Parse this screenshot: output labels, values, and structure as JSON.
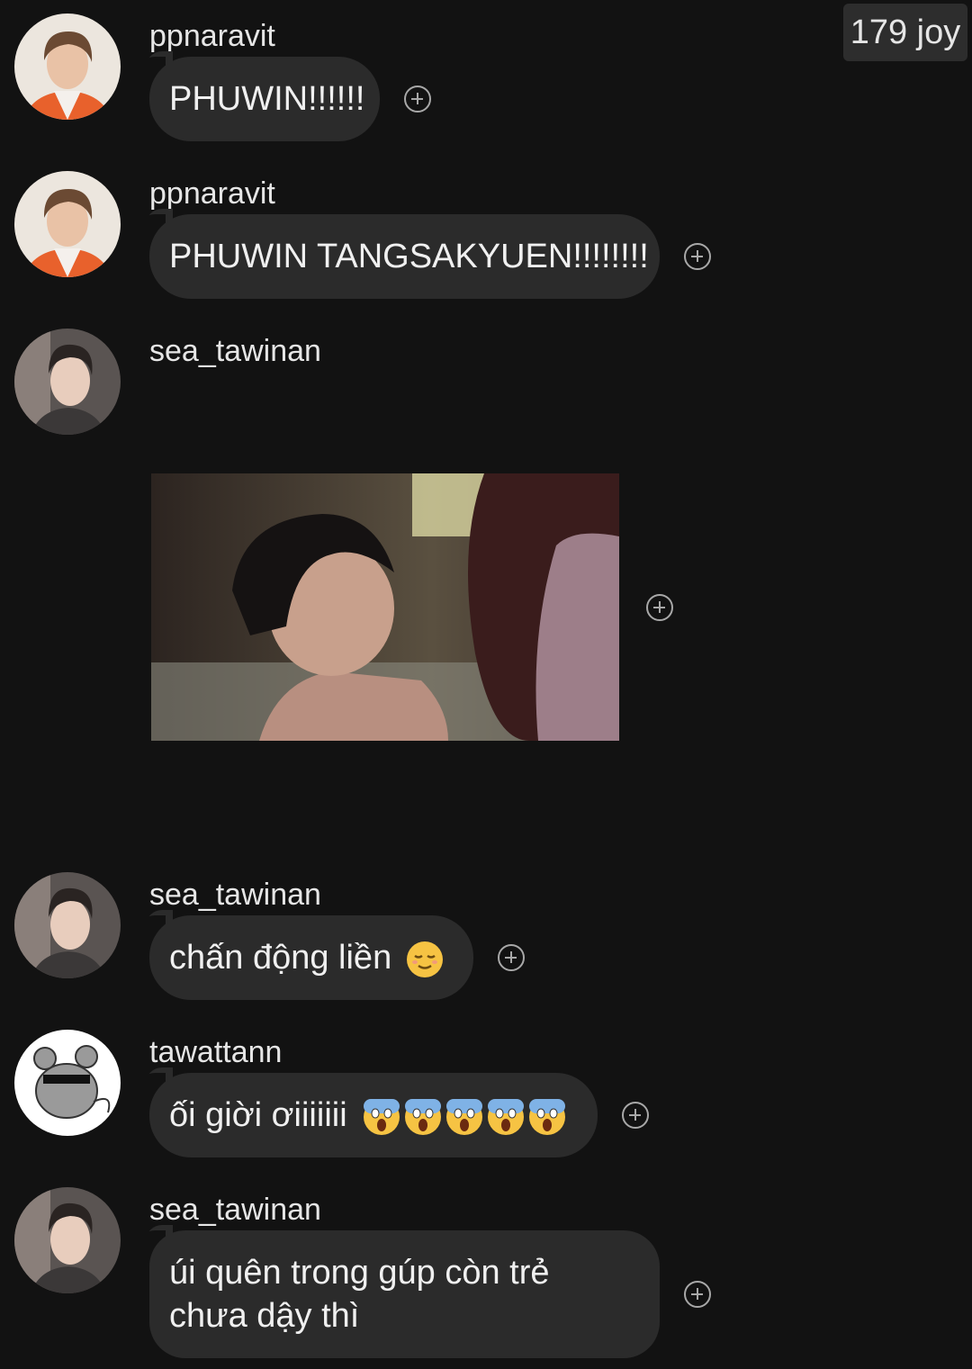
{
  "header": {
    "badge": "179 joy"
  },
  "messages": [
    {
      "username": "ppnaravit",
      "text": "PHUWIN!!!!!!"
    },
    {
      "username": "ppnaravit",
      "text": "PHUWIN TANGSAKYUEN!!!!!!!!"
    },
    {
      "username": "sea_tawinan",
      "attachment": "photo"
    },
    {
      "username": "sea_tawinan",
      "text": "chấn động liền",
      "emoji": "relieved-face"
    },
    {
      "username": "tawattann",
      "text": "ối giời ơiiiiiii",
      "emoji": "screaming-face x5"
    },
    {
      "username": "sea_tawinan",
      "line1": "úi quên trong gúp còn trẻ",
      "line2": "chưa dậy thì"
    }
  ],
  "colors": {
    "background": "#121212",
    "bubble": "#2b2b2b",
    "text": "#f0f0f0"
  }
}
